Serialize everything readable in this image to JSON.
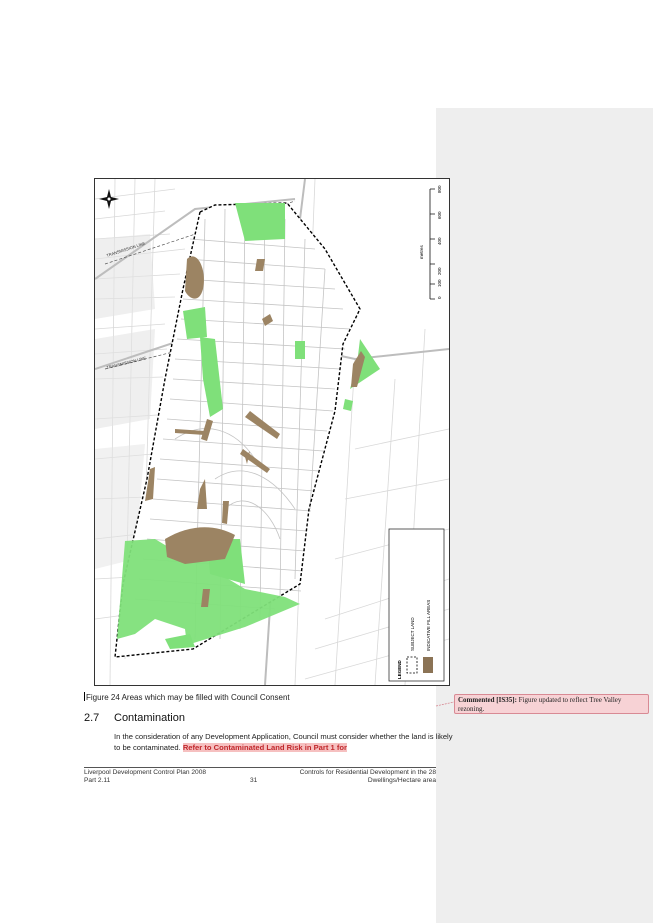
{
  "map": {
    "scale_unit": "metres",
    "scale_ticks": [
      "0",
      "100",
      "200",
      "400",
      "600",
      "800"
    ],
    "road_labels": [
      "TRANSMISSION LINE",
      "TRANSMISSION LINE"
    ],
    "legend": {
      "title": "LEGEND",
      "items": [
        {
          "label": "SUBJECT LAND",
          "swatch": "dashed-box"
        },
        {
          "label": "INDICATIVE FILL AREAS",
          "swatch": "#8b7355"
        }
      ]
    },
    "colors": {
      "green": "#7fe07a",
      "fill": "#9c8463",
      "roads": "#c8c8c8",
      "boundary": "#000000"
    }
  },
  "figure_caption": "Figure 24  Areas which may be filled with Council Consent",
  "section": {
    "number": "2.7",
    "title": "Contamination",
    "body_plain": "In the consideration of any Development Application, Council must consider whether the land is likely to be contaminated. ",
    "body_highlight": "Refer to Contaminated Land Risk in Part 1 for"
  },
  "footer": {
    "left_line1": "Liverpool Development Control Plan 2008",
    "left_line2": "Part 2.11",
    "page": "31",
    "right_line1": "Controls for Residential Development in the 28",
    "right_line2": "Dwellings/Hectare area"
  },
  "comment": {
    "author": "Commented [IS35]:",
    "text": " Figure updated to reflect Tree Valley rezoning."
  }
}
